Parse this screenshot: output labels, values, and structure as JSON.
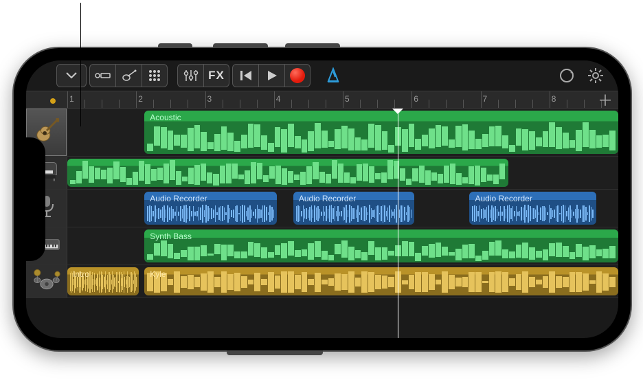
{
  "ruler": {
    "bars": [
      1,
      2,
      3,
      4,
      5,
      6,
      7,
      8
    ],
    "playhead_bar": 5.8
  },
  "tracks": [
    {
      "instrument": "acoustic-guitar",
      "selected": true,
      "regions": [
        {
          "label": "Acoustic",
          "start": 0.14,
          "end": 1.0,
          "color": "green",
          "type": "midi"
        }
      ]
    },
    {
      "instrument": "piano",
      "selected": false,
      "regions": [
        {
          "label": "",
          "start": 0.0,
          "end": 0.8,
          "color": "green",
          "type": "midi"
        }
      ]
    },
    {
      "instrument": "microphone",
      "selected": false,
      "regions": [
        {
          "label": "Audio Recorder",
          "start": 0.14,
          "end": 0.38,
          "color": "blue",
          "type": "audio"
        },
        {
          "label": "Audio Recorder",
          "start": 0.41,
          "end": 0.63,
          "color": "blue",
          "type": "audio"
        },
        {
          "label": "Audio Recorder",
          "start": 0.73,
          "end": 0.96,
          "color": "blue",
          "type": "audio"
        }
      ]
    },
    {
      "instrument": "synth",
      "selected": false,
      "regions": [
        {
          "label": "Synth Bass",
          "start": 0.14,
          "end": 1.0,
          "color": "green",
          "type": "midi"
        }
      ]
    },
    {
      "instrument": "drums",
      "selected": false,
      "regions": [
        {
          "label": "Intro",
          "start": 0.0,
          "end": 0.13,
          "color": "yellow",
          "type": "audio"
        },
        {
          "label": "Kyle",
          "start": 0.14,
          "end": 1.0,
          "color": "yellow",
          "type": "audio"
        }
      ]
    }
  ],
  "toolbar": {
    "fx_label": "FX",
    "metronome_color": "#2d9cdb",
    "record_color": "#e31b0c"
  }
}
